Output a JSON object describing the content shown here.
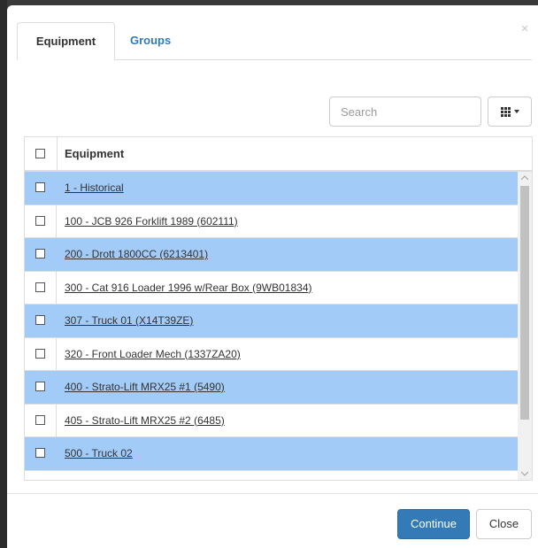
{
  "dialog": {
    "close_glyph": "×",
    "tabs": [
      {
        "label": "Equipment",
        "active": true
      },
      {
        "label": "Groups",
        "active": false
      }
    ]
  },
  "toolbar": {
    "search_placeholder": "Search",
    "columns_icon": "grid-icon"
  },
  "table": {
    "header": "Equipment",
    "rows": [
      {
        "label": "1 - Historical",
        "highlighted": true
      },
      {
        "label": "100 - JCB 926 Forklift 1989 (602111)",
        "highlighted": false
      },
      {
        "label": "200 - Drott 1800CC (6213401)",
        "highlighted": true
      },
      {
        "label": "300 - Cat 916 Loader 1996 w/Rear Box (9WB01834)",
        "highlighted": false
      },
      {
        "label": "307 - Truck 01 (X14T39ZE)",
        "highlighted": true
      },
      {
        "label": "320 - Front Loader Mech (1337ZA20)",
        "highlighted": false
      },
      {
        "label": "400 - Strato-Lift MRX25 #1 (5490)",
        "highlighted": true
      },
      {
        "label": "405 - Strato-Lift MRX25 #2 (6485)",
        "highlighted": false
      },
      {
        "label": "500 - Truck 02",
        "highlighted": true
      }
    ]
  },
  "footer": {
    "continue_label": "Continue",
    "close_label": "Close"
  },
  "colors": {
    "primary": "#337ab7",
    "row_highlight": "#a3cbf8",
    "link": "#337ab7"
  }
}
